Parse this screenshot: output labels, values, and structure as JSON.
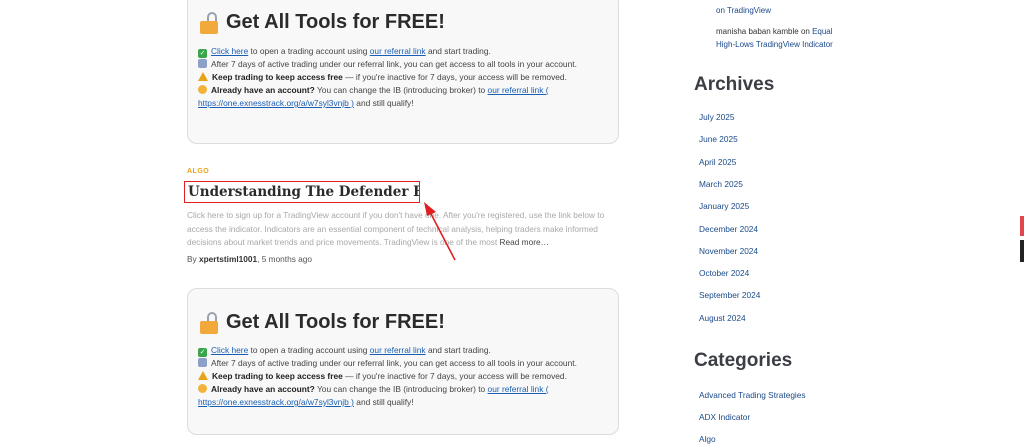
{
  "promo": {
    "title": "Get All Tools for FREE!",
    "line1_link": "Click here",
    "line1_mid": " to open a trading account using ",
    "line1_link2": "our referral link",
    "line1_end": " and start trading.",
    "line2": "After 7 days of active trading under our referral link, you can get access to all tools in your account.",
    "line3_bold": "Keep trading to keep access free",
    "line3_end": " — if you're inactive for 7 days, your access will be removed.",
    "line4_bold": "Already have an account?",
    "line4_mid": " You can change the IB (introducing broker) to ",
    "line4_link": "our referral link (",
    "line5_link": "https://one.exnesstrack.org/a/w7syl3vnjb )",
    "line5_end": " and still qualify!"
  },
  "post": {
    "tag": "ALGO",
    "title": "Understanding The Defender EA",
    "excerpt": "Click here to sign up for a TradingView account if you don't have one. After you're registered, use the link below to access the indicator. Indicators are an essential component of technical analysis, helping traders make informed decisions about market trends and price movements. TradingView is one of the most",
    "read_more": "Read more…",
    "author": "xpertstiml1001",
    "date_suffix": ", 5 months ago",
    "by": "By "
  },
  "sidebar": {
    "comment1_link": "on TradingView",
    "comment2_author": "manisha baban kamble",
    "comment2_on": " on ",
    "comment2_link1": "Equal",
    "comment2_link2": "High-Lows TradingView Indicator",
    "archives_title": "Archives",
    "archives": [
      "July 2025",
      "June 2025",
      "April 2025",
      "March 2025",
      "January 2025",
      "December 2024",
      "November 2024",
      "October 2024",
      "September 2024",
      "August 2024"
    ],
    "categories_title": "Categories",
    "categories": [
      "Advanced Trading Strategies",
      "ADX Indicator",
      "Algo"
    ]
  }
}
